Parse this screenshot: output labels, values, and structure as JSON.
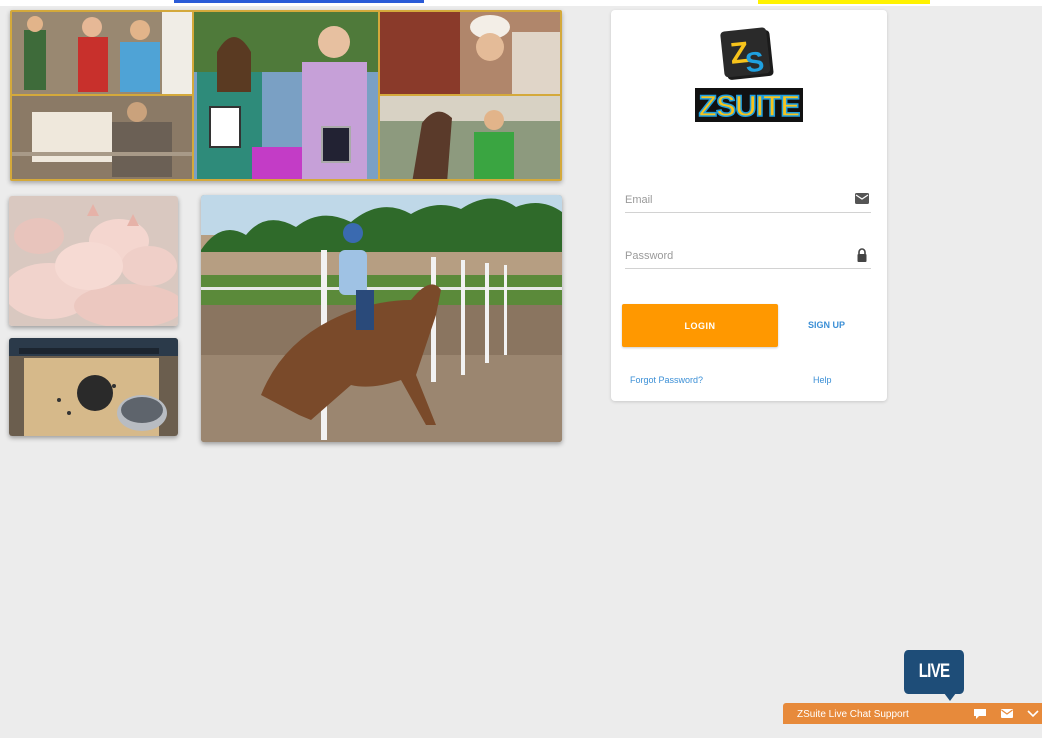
{
  "login": {
    "email_placeholder": "Email",
    "password_placeholder": "Password",
    "login_label": "LOGIN",
    "signup_label": "SIGN UP",
    "forgot_label": "Forgot Password?",
    "help_label": "Help"
  },
  "brand": {
    "logo_text": "ZSUITE",
    "logo_mark": "ZS"
  },
  "chat": {
    "badge_label": "LIVE CHAT",
    "bar_label": "ZSuite Live Chat Support",
    "icons": [
      "chat-bubble-icon",
      "email-icon",
      "minimize-icon"
    ]
  },
  "colors": {
    "accent": "#ff9800",
    "link": "#3b8fd6",
    "chat_badge": "#1e4d78",
    "chat_bar": "#e78a3b",
    "background": "#ececec"
  }
}
